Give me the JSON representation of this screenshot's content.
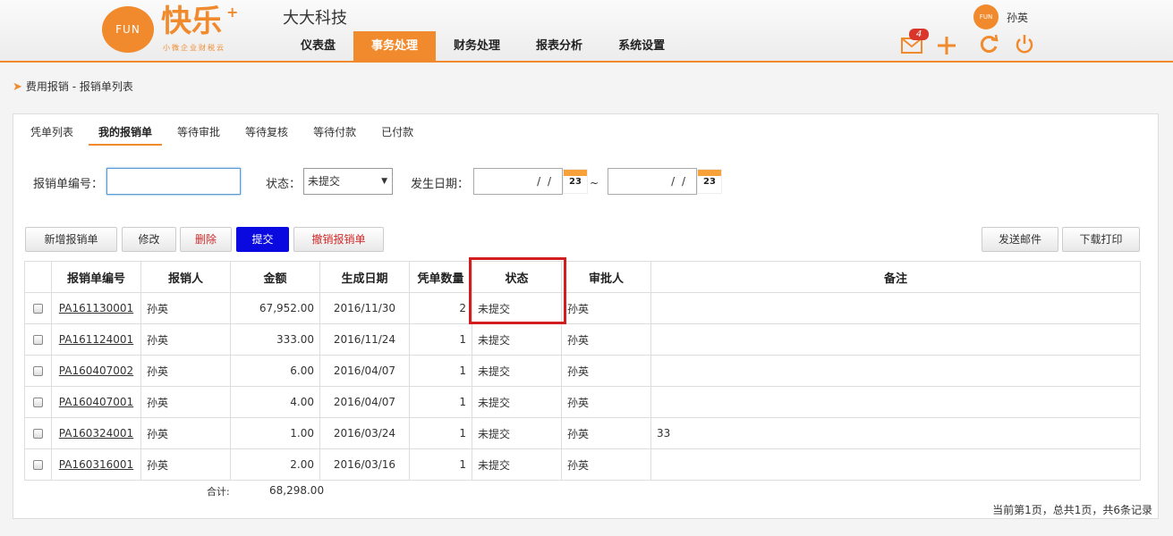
{
  "header": {
    "logo_mark": "FUN",
    "logo_text": "快乐",
    "logo_plus": "+",
    "logo_sub": "小微企业财税云",
    "company": "大大科技",
    "nav": [
      {
        "label": "仪表盘"
      },
      {
        "label": "事务处理",
        "active": true
      },
      {
        "label": "财务处理"
      },
      {
        "label": "报表分析"
      },
      {
        "label": "系统设置"
      }
    ],
    "mail_count": "4",
    "avatar_text": "FUN",
    "user": "孙英",
    "accent": "#f08a2c"
  },
  "breadcrumb": "费用报销 - 报销单列表",
  "tabs": [
    {
      "label": "凭单列表"
    },
    {
      "label": "我的报销单",
      "active": true
    },
    {
      "label": "等待审批"
    },
    {
      "label": "等待复核"
    },
    {
      "label": "等待付款"
    },
    {
      "label": "已付款"
    }
  ],
  "filters": {
    "number_label": "报销单编号：",
    "number_value": "",
    "status_label": "状态：",
    "status_value": "未提交",
    "date_label": "发生日期：",
    "date_from": "/ /",
    "date_to": "/ /",
    "cal_day": "23",
    "tilde": "~"
  },
  "buttons": {
    "add": "新增报销单",
    "edit": "修改",
    "delete": "删除",
    "submit": "提交",
    "revoke": "撤销报销单",
    "email": "发送邮件",
    "print": "下载打印"
  },
  "table": {
    "headers": [
      "报销单编号",
      "报销人",
      "金额",
      "生成日期",
      "凭单数量",
      "状态",
      "审批人",
      "备注"
    ],
    "rows": [
      {
        "id": "PA161130001",
        "person": "孙英",
        "amount": "67,952.00",
        "date": "2016/11/30",
        "count": "2",
        "status": "未提交",
        "approver": "孙英",
        "note": ""
      },
      {
        "id": "PA161124001",
        "person": "孙英",
        "amount": "333.00",
        "date": "2016/11/24",
        "count": "1",
        "status": "未提交",
        "approver": "孙英",
        "note": ""
      },
      {
        "id": "PA160407002",
        "person": "孙英",
        "amount": "6.00",
        "date": "2016/04/07",
        "count": "1",
        "status": "未提交",
        "approver": "孙英",
        "note": ""
      },
      {
        "id": "PA160407001",
        "person": "孙英",
        "amount": "4.00",
        "date": "2016/04/07",
        "count": "1",
        "status": "未提交",
        "approver": "孙英",
        "note": ""
      },
      {
        "id": "PA160324001",
        "person": "孙英",
        "amount": "1.00",
        "date": "2016/03/24",
        "count": "1",
        "status": "未提交",
        "approver": "孙英",
        "note": "33"
      },
      {
        "id": "PA160316001",
        "person": "孙英",
        "amount": "2.00",
        "date": "2016/03/16",
        "count": "1",
        "status": "未提交",
        "approver": "孙英",
        "note": ""
      }
    ],
    "total_label": "合计:",
    "total_value": "68,298.00"
  },
  "pager": "当前第1页，总共1页，共6条记录"
}
